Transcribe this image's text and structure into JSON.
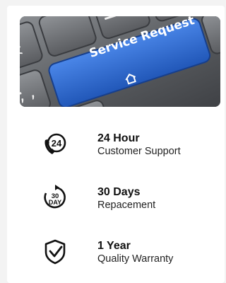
{
  "banner": {
    "key_label": "Service Request",
    "key_color": "#2f6fd6",
    "icon": "home-outline-icon"
  },
  "features": [
    {
      "icon": "phone-24h-icon",
      "icon_text": "24",
      "title": "24 Hour",
      "subtitle": "Customer Support"
    },
    {
      "icon": "30-day-cycle-icon",
      "icon_text_top": "30",
      "icon_text_bottom": "DAY",
      "title": "30 Days",
      "subtitle": "Repacement"
    },
    {
      "icon": "shield-check-icon",
      "title": "1 Year",
      "subtitle": "Quality Warranty"
    }
  ]
}
